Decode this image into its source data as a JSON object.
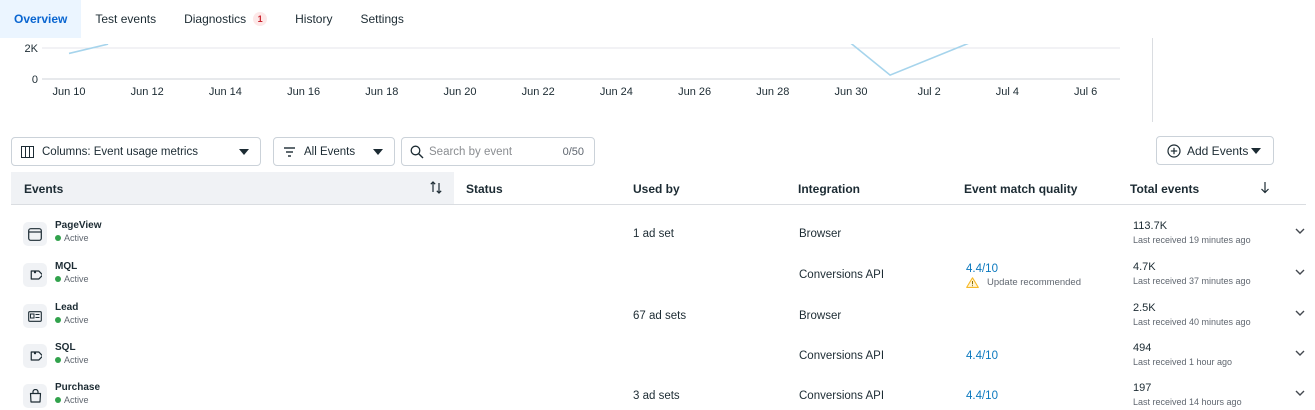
{
  "tabs": [
    {
      "label": "Overview",
      "active": true
    },
    {
      "label": "Test events"
    },
    {
      "label": "Diagnostics",
      "badge": "1"
    },
    {
      "label": "History"
    },
    {
      "label": "Settings"
    }
  ],
  "chart_data": {
    "type": "line",
    "y_ticks": [
      "2K",
      "0"
    ],
    "x_ticks": [
      "Jun 10",
      "Jun 12",
      "Jun 14",
      "Jun 16",
      "Jun 18",
      "Jun 20",
      "Jun 22",
      "Jun 24",
      "Jun 26",
      "Jun 28",
      "Jun 30",
      "Jul 2",
      "Jul 4",
      "Jul 6"
    ],
    "visible_segments": [
      {
        "x": [
          "Jun 10",
          "Jun 11"
        ],
        "y": [
          1650,
          2250
        ]
      },
      {
        "x": [
          "Jun 30",
          "Jul 1",
          "Jul 3"
        ],
        "y": [
          2300,
          250,
          2300
        ]
      }
    ],
    "line_color": "#a6d4ec"
  },
  "toolbar": {
    "columns_label": "Columns: Event usage metrics",
    "filter_label": "All Events",
    "search_placeholder": "Search by event",
    "search_counter": "0/50",
    "add_events_label": "Add Events"
  },
  "table": {
    "headers": {
      "events": "Events",
      "status": "Status",
      "used_by": "Used by",
      "integration": "Integration",
      "emq": "Event match quality",
      "total": "Total events"
    },
    "rows": [
      {
        "name": "PageView",
        "status": "Active",
        "icon": "browser-window-icon",
        "used_by": "1 ad set",
        "integration": "Browser",
        "emq": "",
        "emq_note": "",
        "total": "113.7K",
        "last": "Last received 19 minutes ago"
      },
      {
        "name": "MQL",
        "status": "Active",
        "icon": "tag-icon",
        "used_by": "",
        "integration": "Conversions API",
        "emq": "4.4/10",
        "emq_note": "Update recommended",
        "total": "4.7K",
        "last": "Last received 37 minutes ago"
      },
      {
        "name": "Lead",
        "status": "Active",
        "icon": "id-card-icon",
        "used_by": "67 ad sets",
        "integration": "Browser",
        "emq": "",
        "emq_note": "",
        "total": "2.5K",
        "last": "Last received 40 minutes ago"
      },
      {
        "name": "SQL",
        "status": "Active",
        "icon": "tag-icon",
        "used_by": "",
        "integration": "Conversions API",
        "emq": "4.4/10",
        "emq_note": "",
        "total": "494",
        "last": "Last received 1 hour ago"
      },
      {
        "name": "Purchase",
        "status": "Active",
        "icon": "shopping-bag-icon",
        "used_by": "3 ad sets",
        "integration": "Conversions API",
        "emq": "4.4/10",
        "emq_note": "",
        "total": "197",
        "last": "Last received 14 hours ago"
      }
    ]
  },
  "colors": {
    "accent": "#0a66d1",
    "active_dot": "#31a24c",
    "link": "#0a78be",
    "warning": "#f7b928"
  }
}
